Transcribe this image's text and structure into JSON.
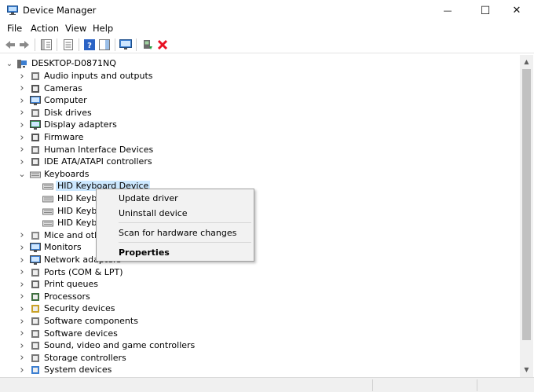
{
  "window": {
    "title": "Device Manager",
    "minimize_glyph": "—",
    "maximize_glyph": "☐",
    "close_glyph": "✕"
  },
  "menu": [
    "File",
    "Action",
    "View",
    "Help"
  ],
  "toolbar": {
    "icons": [
      "back-arrow-icon",
      "forward-arrow-icon",
      "show-hide-console-tree-icon",
      "properties-sheet-icon",
      "help-icon",
      "action-pane-icon",
      "scan-monitor-icon",
      "add-driver-icon",
      "uninstall-x-icon"
    ]
  },
  "tree": {
    "root": "DESKTOP-D0871NQ",
    "categories": [
      {
        "label": "Audio inputs and outputs",
        "icon": "speaker-icon"
      },
      {
        "label": "Cameras",
        "icon": "camera-icon"
      },
      {
        "label": "Computer",
        "icon": "computer-icon"
      },
      {
        "label": "Disk drives",
        "icon": "disk-drive-icon"
      },
      {
        "label": "Display adapters",
        "icon": "display-adapter-icon"
      },
      {
        "label": "Firmware",
        "icon": "firmware-icon"
      },
      {
        "label": "Human Interface Devices",
        "icon": "hid-icon"
      },
      {
        "label": "IDE ATA/ATAPI controllers",
        "icon": "ide-controller-icon"
      },
      {
        "label": "Keyboards",
        "icon": "keyboard-icon",
        "expanded": true
      },
      {
        "label": "Mice and othe",
        "icon": "mouse-icon"
      },
      {
        "label": "Monitors",
        "icon": "monitor-icon"
      },
      {
        "label": "Network adapters",
        "icon": "network-adapter-icon"
      },
      {
        "label": "Ports (COM & LPT)",
        "icon": "port-icon"
      },
      {
        "label": "Print queues",
        "icon": "printer-icon"
      },
      {
        "label": "Processors",
        "icon": "processor-icon"
      },
      {
        "label": "Security devices",
        "icon": "security-device-icon"
      },
      {
        "label": "Software components",
        "icon": "software-component-icon"
      },
      {
        "label": "Software devices",
        "icon": "software-device-icon"
      },
      {
        "label": "Sound, video and game controllers",
        "icon": "sound-icon"
      },
      {
        "label": "Storage controllers",
        "icon": "storage-controller-icon"
      },
      {
        "label": "System devices",
        "icon": "system-device-icon"
      }
    ],
    "keyboard_children": [
      "HID Keyboard Device",
      "HID Keybo",
      "HID Keybo",
      "HID Keybo"
    ],
    "selected_child": 0
  },
  "context_menu": {
    "update": "Update driver",
    "uninstall": "Uninstall device",
    "scan": "Scan for hardware changes",
    "properties": "Properties"
  },
  "scrollbar": {
    "up": "▲",
    "down": "▼"
  },
  "colors": {
    "selection": "#cce8ff",
    "menu_bg": "#f2f2f2",
    "uninstall_red": "#e81123"
  }
}
